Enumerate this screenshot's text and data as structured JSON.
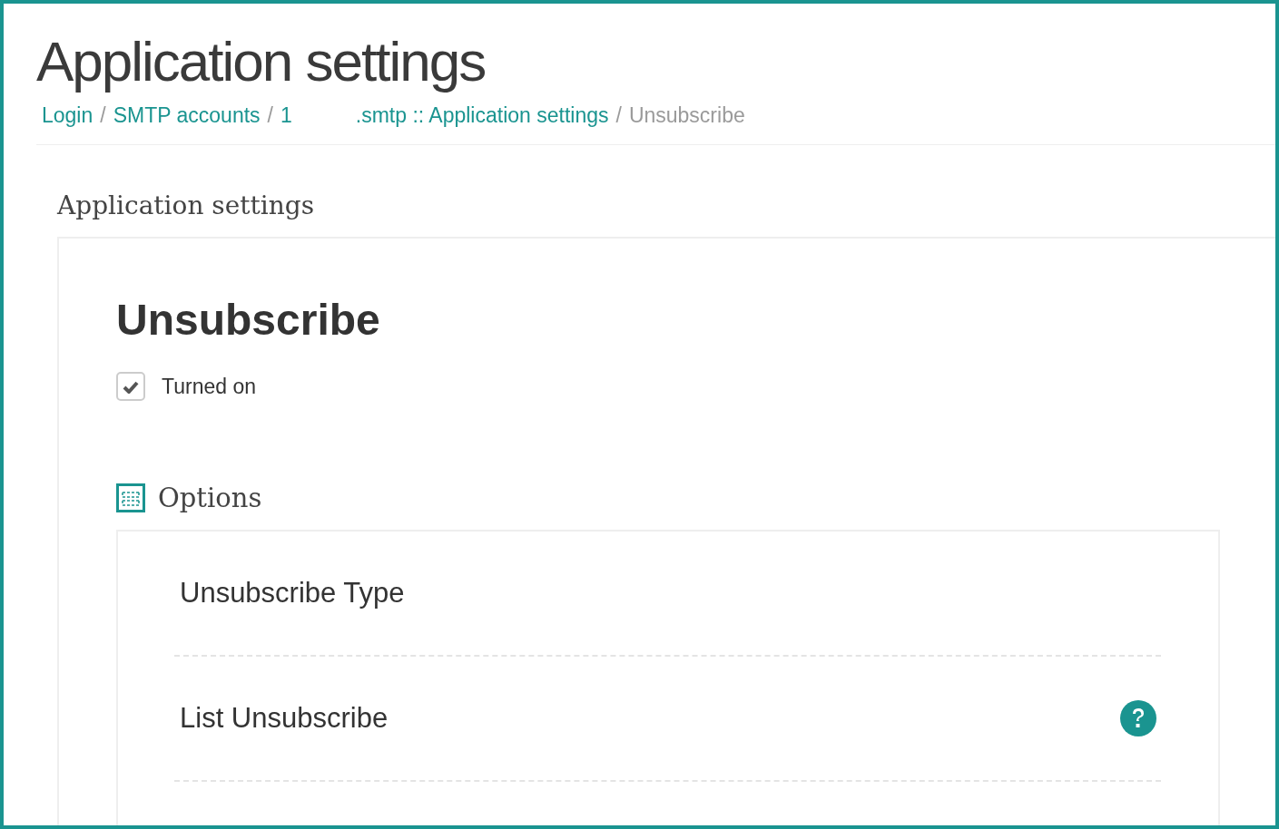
{
  "page_title": "Application settings",
  "breadcrumb": [
    {
      "text": "Login",
      "kind": "link",
      "separator_after": "/"
    },
    {
      "text": "SMTP accounts",
      "kind": "link",
      "separator_after": "/"
    },
    {
      "text": "1",
      "kind": "link"
    },
    {
      "text": ".smtp :: Application settings",
      "kind": "link",
      "separator_after": "/"
    },
    {
      "text": "Unsubscribe",
      "kind": "current"
    }
  ],
  "section_title": "Application settings",
  "panel": {
    "heading": "Unsubscribe",
    "checkbox": {
      "label": "Turned on",
      "checked": true
    },
    "options_title": "Options",
    "options": [
      {
        "label": "Unsubscribe Type",
        "help": false
      },
      {
        "label": "List Unsubscribe",
        "help": true
      }
    ]
  }
}
